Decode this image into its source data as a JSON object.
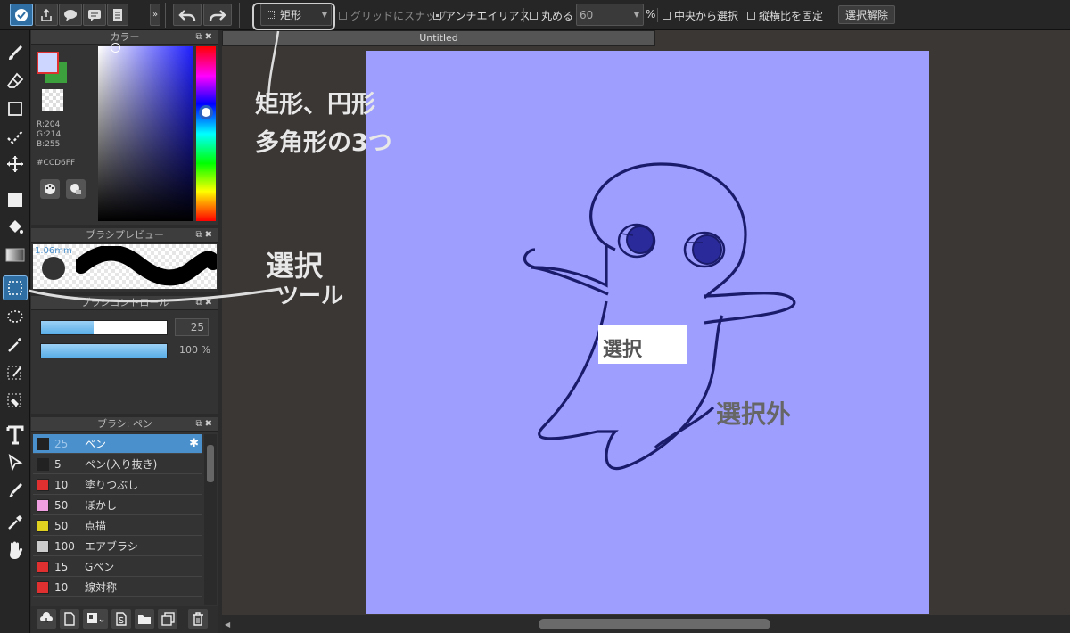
{
  "toolbar": {
    "shape_select": "矩形",
    "snap_grid": "グリッドにスナップ",
    "antialias": "アンチエイリアス",
    "round": "丸める",
    "round_value": "60",
    "round_unit": "%",
    "select_from_center": "中央から選択",
    "fix_aspect": "縦横比を固定",
    "deselect_button": "選択解除"
  },
  "color_panel": {
    "title": "カラー",
    "r": "R:204",
    "g": "G:214",
    "b": "B:255",
    "hex": "#CCD6FF",
    "fg_color": "#ccd6ff",
    "bg_color": "#3ca03c"
  },
  "brush_preview": {
    "title": "ブラシプレビュー",
    "size_label": "1.06mm"
  },
  "brush_control": {
    "title": "ブラシコントロール",
    "size_value": "25",
    "size_fill": 0.42,
    "opacity_value": "100 %",
    "opacity_fill": 1.0
  },
  "brush_list": {
    "title": "ブラシ: ペン",
    "items": [
      {
        "size": "25",
        "name": "ペン",
        "color": "#222222",
        "selected": true
      },
      {
        "size": "5",
        "name": "ペン(入り抜き)",
        "color": "#222222"
      },
      {
        "size": "10",
        "name": "塗りつぶし",
        "color": "#e03030"
      },
      {
        "size": "50",
        "name": "ぼかし",
        "color": "#f0a0e0"
      },
      {
        "size": "50",
        "name": "点描",
        "color": "#e0d020"
      },
      {
        "size": "100",
        "name": "エアブラシ",
        "color": "#cccccc"
      },
      {
        "size": "15",
        "name": "Gペン",
        "color": "#e03030"
      },
      {
        "size": "10",
        "name": "線対称",
        "color": "#e03030"
      }
    ]
  },
  "document": {
    "tab_title": "Untitled",
    "canvas_color": "#9e9eff"
  },
  "annotations": {
    "shapes_line1": "矩形、円形",
    "shapes_line2": "多角形の3つ",
    "select_tool_line1": "選択",
    "select_tool_line2": "ツール",
    "inside_label": "選択",
    "outside_label": "選択外"
  }
}
